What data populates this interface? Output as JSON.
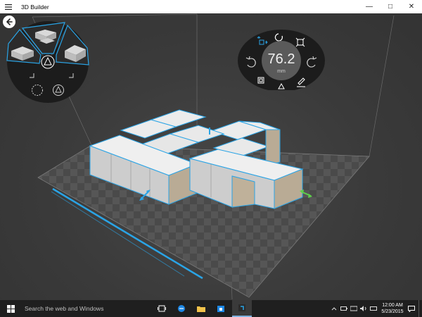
{
  "app": {
    "title": "3D Builder"
  },
  "window_controls": {
    "minimize": "—",
    "maximize": "□",
    "close": "✕"
  },
  "transform": {
    "value": "76.2",
    "unit": "mm"
  },
  "taskbar": {
    "search_placeholder": "Search the web and Windows",
    "time": "12:00 AM",
    "date": "5/23/2015"
  },
  "colors": {
    "accent": "#2aa4e6",
    "title_bar": "#ffffff",
    "taskbar": "#1f1f1f",
    "block_top": "#ececec",
    "block_left": "#c9c9c9",
    "block_right": "#b9ab95",
    "handle_green": "#5ed14b"
  },
  "icons": {
    "hamburger": "hamburger-icon",
    "back": "back-arrow-icon",
    "rotate": "rotate-icon",
    "scale": "scale-icon",
    "move": "move-icon",
    "undo": "undo-icon",
    "redo": "redo-icon",
    "triangle": "triangle-icon",
    "pencil": "pencil-icon",
    "box": "box-icon"
  }
}
